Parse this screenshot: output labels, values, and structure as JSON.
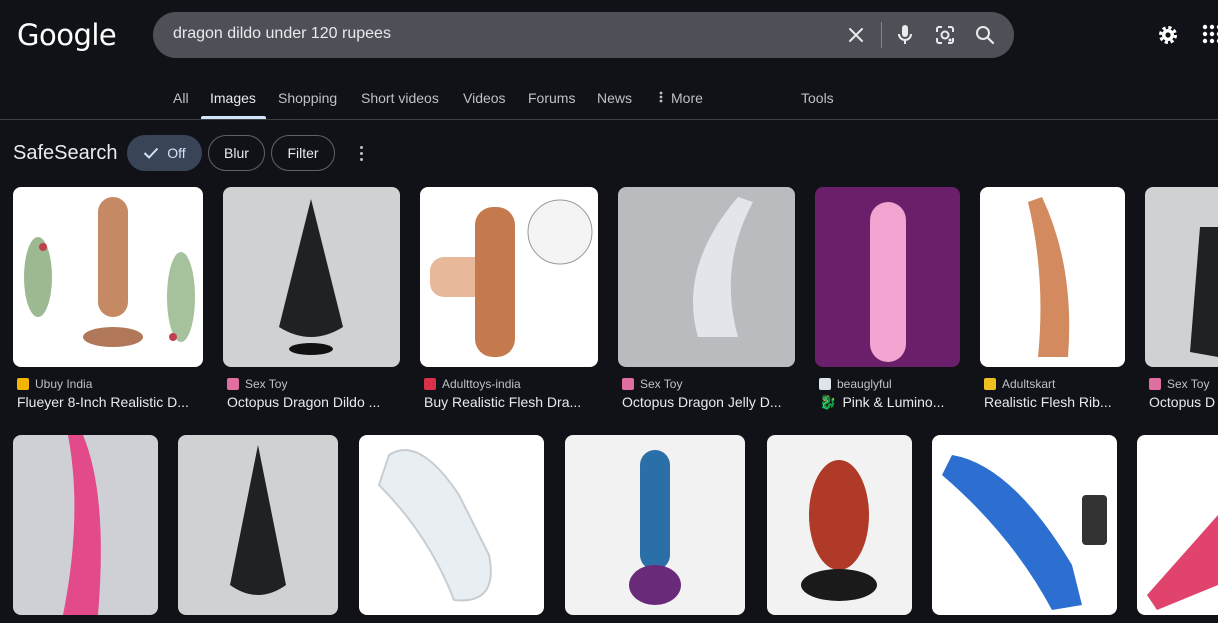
{
  "header": {
    "logo": "Google",
    "query": "dragon dildo under 120 rupees",
    "icons": [
      "close-icon",
      "mic-icon",
      "lens-icon",
      "search-icon",
      "gear-icon",
      "apps-icon"
    ]
  },
  "tabs": [
    {
      "label": "All"
    },
    {
      "label": "Images"
    },
    {
      "label": "Shopping"
    },
    {
      "label": "Short videos"
    },
    {
      "label": "Videos"
    },
    {
      "label": "Forums"
    },
    {
      "label": "News"
    },
    {
      "label": "More"
    },
    {
      "label": "Tools"
    }
  ],
  "safesearch": {
    "title": "SafeSearch",
    "chips": [
      "Off",
      "Blur",
      "Filter"
    ],
    "selected": "Off"
  },
  "results_row1": [
    {
      "source": "Ubuy India",
      "title": "Flueyer 8-Inch Realistic D...",
      "color": "#c58a63"
    },
    {
      "source": "Sex Toy",
      "title": "Octopus Dragon Dildo ...",
      "color": "#202124"
    },
    {
      "source": "Adulttoys-india",
      "title": "Buy Realistic Flesh Dra...",
      "color": "#c47a4c"
    },
    {
      "source": "Sex Toy",
      "title": "Octopus Dragon Jelly D...",
      "color": "#e2e6ea"
    },
    {
      "source": "beauglyful",
      "title": "Pink & Lumino...",
      "color": "#f2a3d0"
    },
    {
      "source": "Adultskart",
      "title": "Realistic Flesh Rib...",
      "color": "#d28a5e"
    },
    {
      "source": "Sex Toy",
      "title": "Octopus D",
      "color": "#202124"
    }
  ],
  "results_row2": [
    {
      "color": "#e24a8a"
    },
    {
      "color": "#202124"
    },
    {
      "color": "#e9eef2"
    },
    {
      "color": "#2a6fa8"
    },
    {
      "color": "#b03a28"
    },
    {
      "color": "#2c6fd0"
    },
    {
      "color": "#e0446c"
    }
  ]
}
